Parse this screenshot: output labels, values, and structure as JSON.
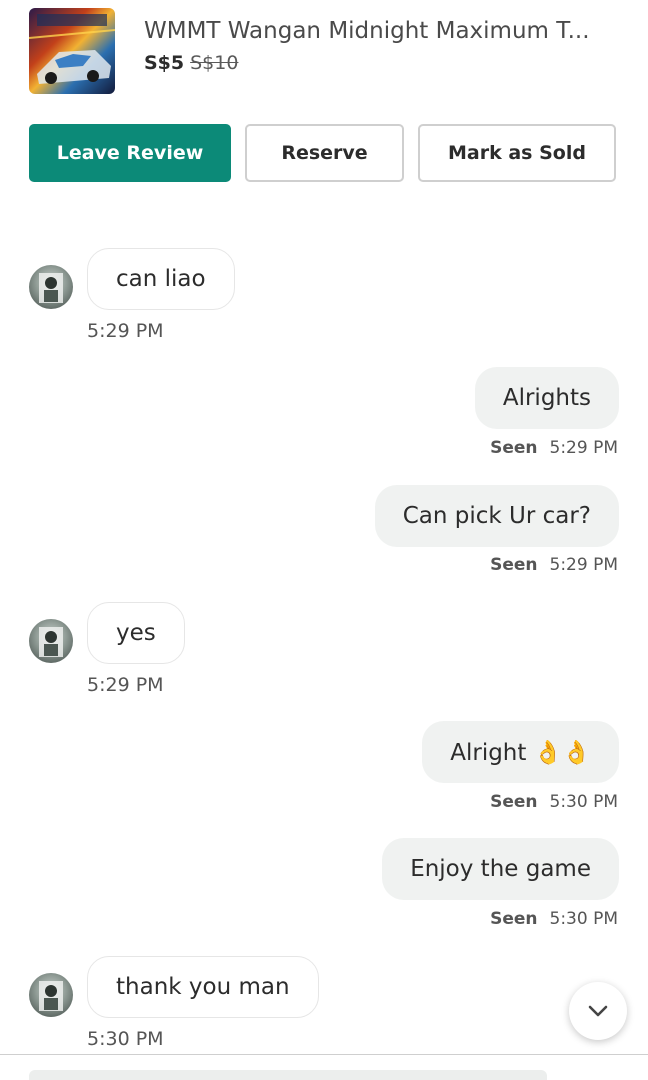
{
  "listing": {
    "title": "WMMT Wangan Midnight Maximum T...",
    "price": "S$5",
    "original_price": "S$10"
  },
  "actions": {
    "leave_review": "Leave Review",
    "reserve": "Reserve",
    "mark_as_sold": "Mark as Sold"
  },
  "messages": [
    {
      "direction": "in",
      "text": "can liao",
      "time": "5:29 PM"
    },
    {
      "direction": "out",
      "text": "Alrights",
      "status": "Seen",
      "time": "5:29 PM"
    },
    {
      "direction": "out",
      "text": "Can pick Ur car?",
      "status": "Seen",
      "time": "5:29 PM"
    },
    {
      "direction": "in",
      "text": "yes",
      "time": "5:29 PM"
    },
    {
      "direction": "out",
      "text": "Alright 👌👌",
      "status": "Seen",
      "time": "5:30 PM"
    },
    {
      "direction": "out",
      "text": "Enjoy the game",
      "status": "Seen",
      "time": "5:30 PM"
    },
    {
      "direction": "in",
      "text": "thank you man",
      "time": "5:30 PM"
    }
  ],
  "icons": {
    "scroll_down": "chevron-down-icon"
  },
  "colors": {
    "primary": "#0c8a78",
    "outgoing_bubble": "#f0f2f1",
    "text": "#2c2c2c"
  }
}
